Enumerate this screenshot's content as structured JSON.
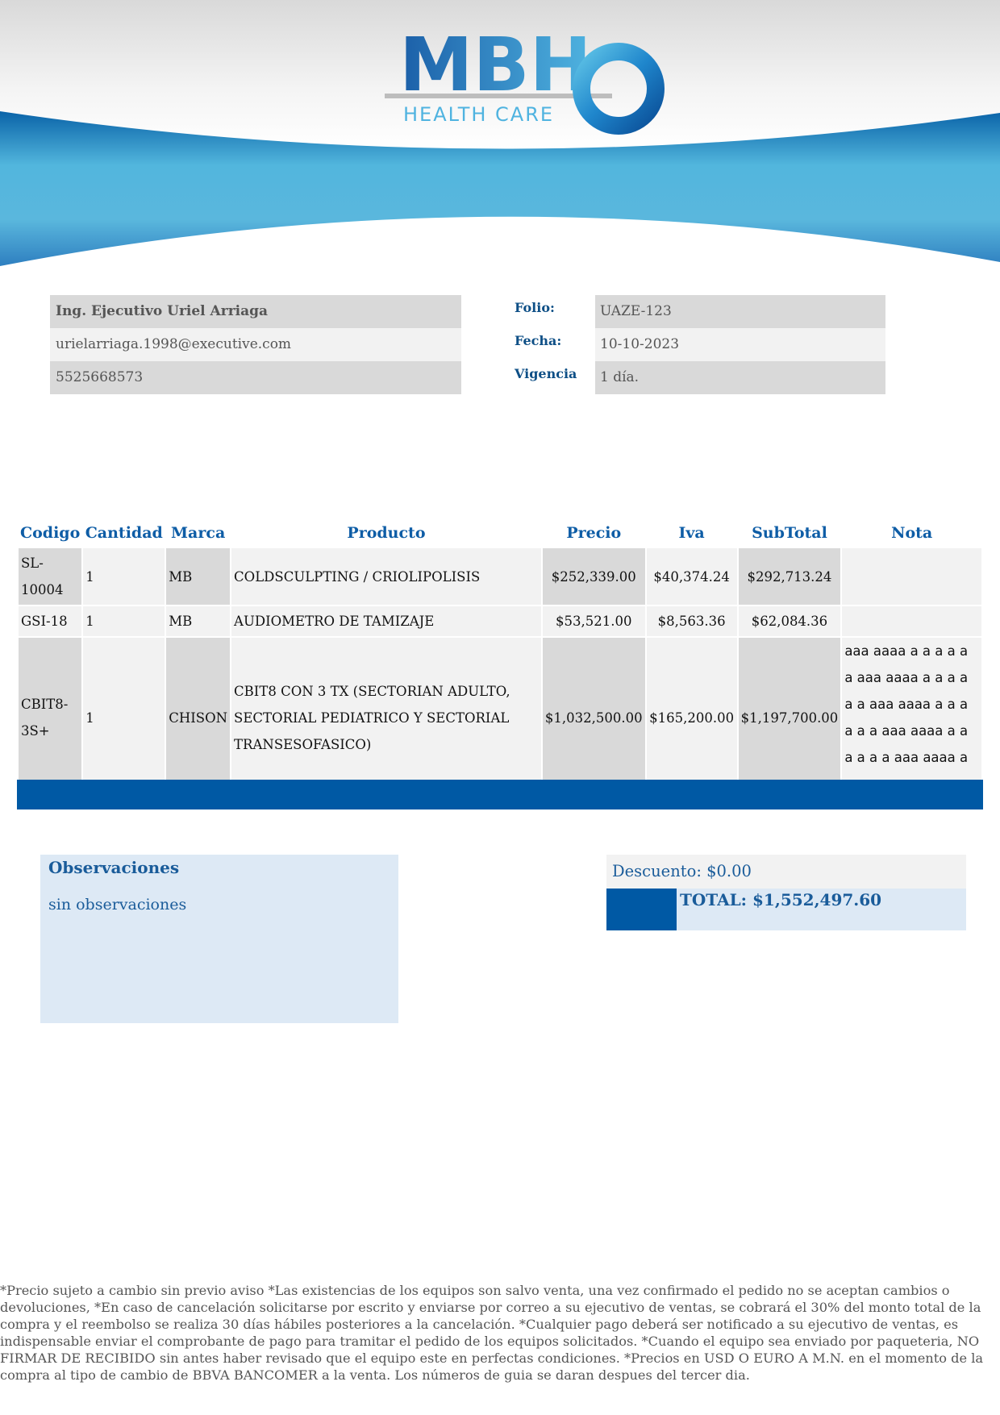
{
  "brand": {
    "logo_letters": "MBH",
    "logo_tagline": "HEALTH CARE",
    "colors": {
      "primary_blue": "#0059a4",
      "light_blue": "#52b6dd",
      "label_blue": "#0e4f86"
    }
  },
  "executive": {
    "name": "Ing. Ejecutivo Uriel Arriaga",
    "email": "urielarriaga.1998@executive.com",
    "phone": "5525668573"
  },
  "meta": {
    "folio_label": "Folio:",
    "folio_value": "UAZE-123",
    "fecha_label": "Fecha:",
    "fecha_value": "10-10-2023",
    "vigencia_label": "Vigencia",
    "vigencia_value": "1 día."
  },
  "items_table": {
    "headers": {
      "codigo": "Codigo",
      "cantidad": "Cantidad",
      "marca": "Marca",
      "producto": "Producto",
      "precio": "Precio",
      "iva": "Iva",
      "subtotal": "SubTotal",
      "nota": "Nota"
    },
    "rows": [
      {
        "codigo": "SL-10004",
        "cantidad": "1",
        "marca": "MB",
        "producto": "COLDSCULPTING / CRIOLIPOLISIS",
        "precio": "$252,339.00",
        "iva": "$40,374.24",
        "subtotal": "$292,713.24",
        "nota": ""
      },
      {
        "codigo": "GSI-18",
        "cantidad": "1",
        "marca": "MB",
        "producto": "AUDIOMETRO DE TAMIZAJE",
        "precio": "$53,521.00",
        "iva": "$8,563.36",
        "subtotal": "$62,084.36",
        "nota": ""
      },
      {
        "codigo": "CBIT8-3S+",
        "cantidad": "1",
        "marca": "CHISON",
        "producto": "CBIT8 CON 3 TX (SECTORIAN ADULTO, SECTORIAL PEDIATRICO Y SECTORIAL TRANSESOFASICO)",
        "precio": "$1,032,500.00",
        "iva": "$165,200.00",
        "subtotal": "$1,197,700.00",
        "nota": "aaa aaaa a a a a a a aaa aaaa a a a a a a aaa aaaa a a a a a a aaa aaaa a a a a a a aaa aaaa a a a a a a"
      }
    ]
  },
  "observaciones": {
    "title": "Observaciones",
    "text": "sin observaciones"
  },
  "totals": {
    "descuento": "Descuento: $0.00",
    "total": "TOTAL: $1,552,497.60"
  },
  "footer": {
    "terms": "*Precio sujeto a cambio sin previo aviso *Las existencias de los equipos son salvo venta, una vez confirmado el pedido no se aceptan cambios o devoluciones, *En caso de cancelación solicitarse por escrito y enviarse por correo a su ejecutivo de ventas, se cobrará el 30% del monto total de la compra y el reembolso se realiza 30 días hábiles posteriores a la cancelación. *Cualquier pago deberá ser notificado a su ejecutivo de ventas, es indispensable enviar el comprobante de pago para tramitar el pedido de los equipos solicitados. *Cuando el equipo sea enviado por paqueteria, NO FIRMAR DE RECIBIDO sin antes haber revisado que el equipo este en perfectas condiciones. *Precios en USD O EURO A M.N. en el momento de la compra al tipo de cambio de BBVA BANCOMER a la venta. Los números de guia se daran despues del tercer dia."
  }
}
